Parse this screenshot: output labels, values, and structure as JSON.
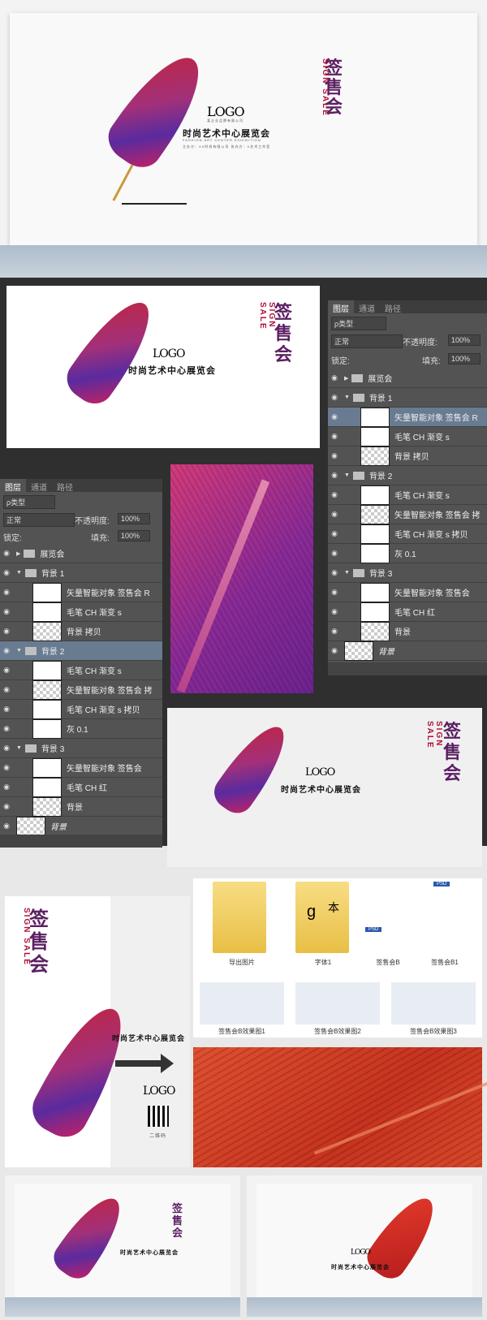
{
  "mockup": {
    "logo": "LOGO",
    "company": "某企业品牌有限公司",
    "title": "时尚艺术中心展览会",
    "subtitle": "FASHION ART CENTER EXHIBITION",
    "credit": "主办方：XX时尚有限公司  协办方：X艺术工作室",
    "sign_cn": "签售会",
    "sign_en": "SIGN SALE"
  },
  "panel_right": {
    "tabs": [
      "图层",
      "通道",
      "路径"
    ],
    "filter": "ρ类型",
    "blend": "正常",
    "opacity_label": "不透明度:",
    "opacity": "100%",
    "lock_label": "锁定:",
    "fill_label": "填充:",
    "fill": "100%",
    "layers": [
      {
        "name": "展览会",
        "type": "folder"
      },
      {
        "name": "背景 1",
        "type": "group"
      },
      {
        "name": "矢量智能对象 签售会 R",
        "type": "layer",
        "sel": true
      },
      {
        "name": "毛笔 CH 渐变 s",
        "type": "layer"
      },
      {
        "name": "背景 拷贝",
        "type": "layer"
      },
      {
        "name": "背景 2",
        "type": "group"
      },
      {
        "name": "毛笔 CH 渐变 s",
        "type": "layer"
      },
      {
        "name": "矢量智能对象 签售会 拷",
        "type": "layer"
      },
      {
        "name": "毛笔 CH 渐变 s 拷贝",
        "type": "layer"
      },
      {
        "name": "灰 0.1",
        "type": "layer"
      },
      {
        "name": "背景 3",
        "type": "group"
      },
      {
        "name": "矢量智能对象 签售会",
        "type": "layer"
      },
      {
        "name": "毛笔 CH 红",
        "type": "layer"
      },
      {
        "name": "背景",
        "type": "layer"
      },
      {
        "name": "背景",
        "type": "base"
      }
    ]
  },
  "panel_left": {
    "tabs": [
      "图层",
      "通道",
      "路径"
    ],
    "filter": "ρ类型",
    "blend": "正常",
    "opacity_label": "不透明度:",
    "opacity": "100%",
    "lock_label": "锁定:",
    "fill_label": "填充:",
    "fill": "100%",
    "layers": [
      {
        "name": "展览会",
        "type": "folder"
      },
      {
        "name": "背景 1",
        "type": "group"
      },
      {
        "name": "矢量智能对象 签售会 R",
        "type": "layer"
      },
      {
        "name": "毛笔 CH 渐变 s",
        "type": "layer"
      },
      {
        "name": "背景 拷贝",
        "type": "layer"
      },
      {
        "name": "背景 2",
        "type": "group",
        "sel": true
      },
      {
        "name": "毛笔 CH 渐变 s",
        "type": "layer"
      },
      {
        "name": "矢量智能对象 签售会 拷",
        "type": "layer"
      },
      {
        "name": "毛笔 CH 渐变 s 拷贝",
        "type": "layer"
      },
      {
        "name": "灰 0.1",
        "type": "layer"
      },
      {
        "name": "背景 3",
        "type": "group"
      },
      {
        "name": "矢量智能对象 签售会",
        "type": "layer"
      },
      {
        "name": "毛笔 CH 红",
        "type": "layer"
      },
      {
        "name": "背景",
        "type": "layer"
      },
      {
        "name": "背景",
        "type": "base"
      }
    ]
  },
  "files": {
    "items": [
      "导出图片",
      "字体1",
      "签售会B",
      "签售会B1"
    ],
    "previews": [
      "签售会B效果图1",
      "签售会B效果图2",
      "签售会B效果图3"
    ],
    "psd": "PSD",
    "glyph_a": "g",
    "glyph_b": "本"
  },
  "poster": {
    "qr_label": "二维码"
  }
}
